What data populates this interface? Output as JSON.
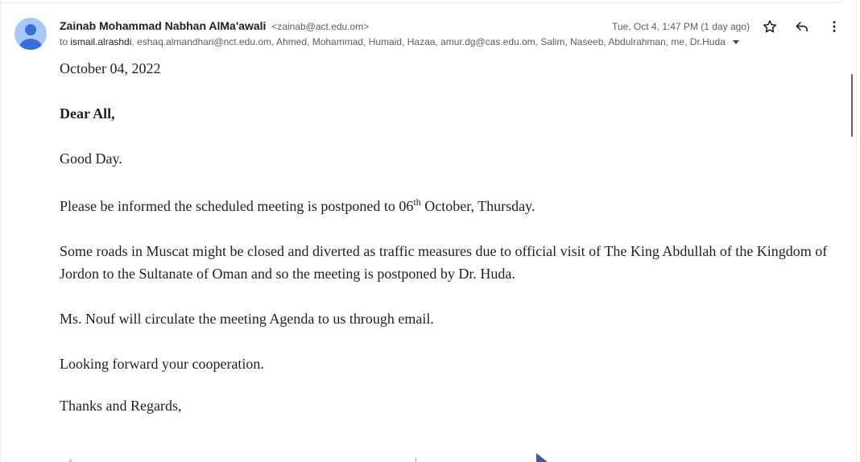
{
  "email": {
    "sender_name": "Zainab Mohammad Nabhan AlMa'awali",
    "sender_email": "<zainab@act.edu.om>",
    "to_prefix": "to",
    "to_first": "ismail.alrashdi",
    "to_rest": ", eshaq.almandhari@nct.edu.om, Ahmed, Mohammad, Humaid, Hazaa, amur.dg@cas.edu.om, Salim, Naseeb, Abdulrahman, me, Dr.Huda",
    "timestamp": "Tue, Oct 4, 1:47 PM (1 day ago)"
  },
  "actions": {
    "star_icon": "star-icon",
    "reply_icon": "reply-icon",
    "more_icon": "more-vert-icon"
  },
  "body": {
    "date": "October 04, 2022",
    "greeting": "Dear All,",
    "good_day": "Good Day.",
    "para1_before": "Please be informed the scheduled meeting is postponed to 06",
    "para1_sup": "th",
    "para1_after": " October, Thursday.",
    "para2": "Some roads in Muscat might be closed and diverted as traffic measures due to official visit of The King Abdullah of the Kingdom of Jordon to the Sultanate of Oman and so the meeting is postponed by Dr. Huda.",
    "para3": "Ms. Nouf will circulate the meeting Agenda to us through email.",
    "para4": "Looking forward your cooperation.",
    "closing": "Thanks and Regards,"
  },
  "colors": {
    "avatar_bg": "#a8c7fa",
    "avatar_fg": "#3b6fd8",
    "text": "#1f1f1f",
    "secondary": "#5e5e5e"
  }
}
